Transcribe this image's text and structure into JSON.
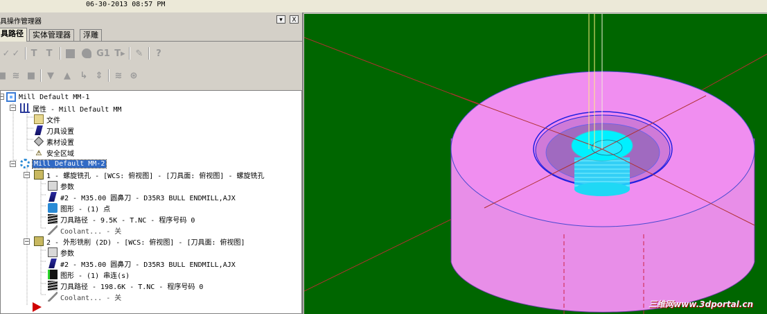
{
  "datetime": "06-30-2013 08:57 PM",
  "panel": {
    "title": "具操作管理器",
    "min_btn": "▾",
    "close_btn": "X",
    "tabs": [
      "具路径",
      "实体管理器",
      "浮雕"
    ]
  },
  "toolbar1": {
    "icons": [
      "select-all-icon",
      "select-invalid-icon",
      "regen-selected-icon",
      "regen-dirty-icon",
      "backplot-icon",
      "verify-icon",
      "g1-post-icon",
      "high-speed-icon",
      "wrench-icon",
      "help-icon"
    ],
    "g1_label": "G1",
    "help_label": "?"
  },
  "toolbar2": {
    "icons": [
      "lock-icon",
      "toggle-display-icon",
      "posting-lock-icon",
      "move-down-icon",
      "move-up-icon",
      "insert-arrow-icon",
      "scroll-icon",
      "wave-icon",
      "globe-icon"
    ]
  },
  "tree": {
    "machine": "Mill Default MM-1",
    "properties": "属性 - Mill Default MM",
    "files": "文件",
    "tool_settings": "刀具设置",
    "stock_setup": "素材设置",
    "safety_zone": "安全区域",
    "group": "Mill Default MM-2",
    "op1": {
      "title": "1 - 螺旋铣孔 - [WCS: 俯视图] - [刀具面: 俯视图] - 螺旋铣孔",
      "params": "参数",
      "tool": "#2 - M35.00 圆鼻刀 - D35R3 BULL ENDMILL,AJX",
      "geometry": "图形 - (1) 点",
      "toolpath": "刀具路径 - 9.5K - T.NC - 程序号码 0",
      "coolant": "Coolant... - 关"
    },
    "op2": {
      "title": "2 - 外形铣削 (2D) - [WCS: 俯视图] - [刀具面: 俯视图]",
      "params": "参数",
      "tool": "#2 - M35.00 圆鼻刀 - D35R3 BULL ENDMILL,AJX",
      "geometry": "图形 - (1) 串连(s)",
      "toolpath": "刀具路径 - 198.6K - T.NC - 程序号码 0",
      "coolant": "Coolant... - 关"
    }
  },
  "viewport": {
    "watermark": "三维网www.3dportal.cn"
  },
  "colors": {
    "background": "#006600",
    "part": "#ee88ee",
    "tool": "#00e5ff",
    "axes": "#b03030"
  }
}
